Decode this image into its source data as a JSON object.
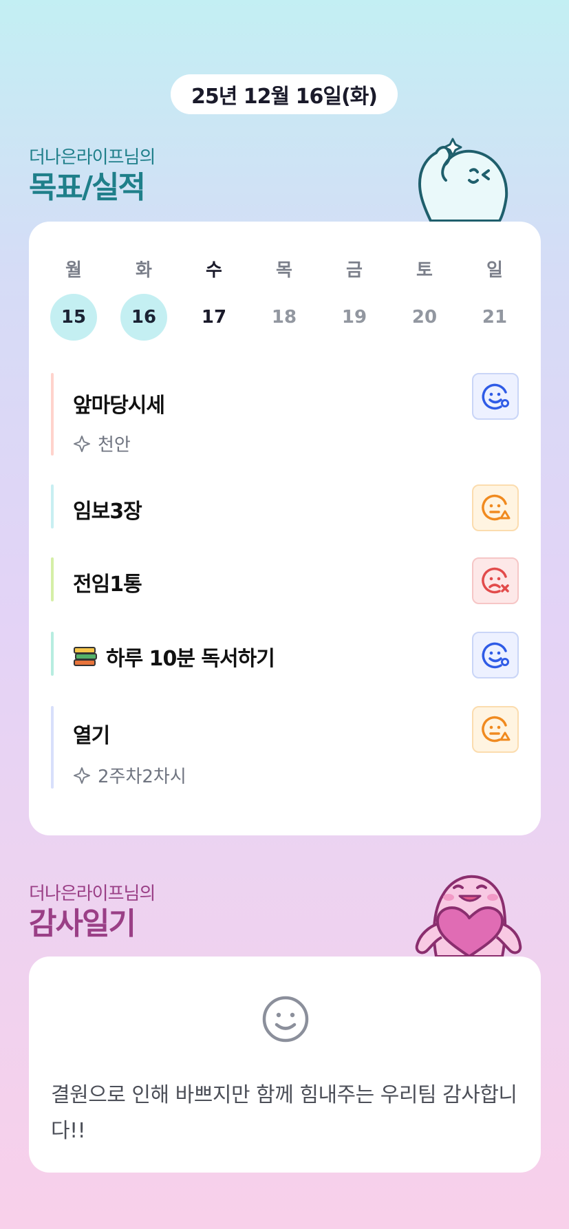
{
  "header": {
    "date": "25년 12월 16일(화)"
  },
  "goal_section": {
    "user_suffix": "더나은라이프님의",
    "title": "목표/실적"
  },
  "week": {
    "days": [
      {
        "name": "월",
        "num": "15",
        "state": "done"
      },
      {
        "name": "화",
        "num": "16",
        "state": "done"
      },
      {
        "name": "수",
        "num": "17",
        "state": "today"
      },
      {
        "name": "목",
        "num": "18",
        "state": "future"
      },
      {
        "name": "금",
        "num": "19",
        "state": "future"
      },
      {
        "name": "토",
        "num": "20",
        "state": "future"
      },
      {
        "name": "일",
        "num": "21",
        "state": "future"
      }
    ]
  },
  "goals": [
    {
      "title": "앞마당시세",
      "note": "천안",
      "bar_color": "#ffd3cc",
      "status": "good",
      "status_icon": "smile-face-icon"
    },
    {
      "title": "임보3장",
      "note": "",
      "bar_color": "#c8eff2",
      "status": "partial",
      "status_icon": "neutral-warning-face-icon"
    },
    {
      "title": "전임1통",
      "note": "",
      "bar_color": "#d5efa7",
      "status": "failed",
      "status_icon": "sad-x-face-icon"
    },
    {
      "title": "하루 10분 독서하기",
      "note": "",
      "emoji": "📚",
      "bar_color": "#b7ede0",
      "status": "good",
      "status_icon": "smile-face-icon"
    },
    {
      "title": "열기",
      "note": "2주차2차시",
      "bar_color": "#d8dffb",
      "status": "partial",
      "status_icon": "neutral-warning-face-icon"
    }
  ],
  "thanks_section": {
    "user_suffix": "더나은라이프님의",
    "title": "감사일기",
    "icon": "smile-icon",
    "text": "결원으로 인해 바쁘지만 함께 힘내주는 우리팀 감사합니다!!"
  },
  "colors": {
    "blue": "#2f5be6",
    "orange": "#f08a1f",
    "red": "#e24b4b",
    "teal": "#1f7f8a",
    "magenta": "#9a3f86"
  }
}
